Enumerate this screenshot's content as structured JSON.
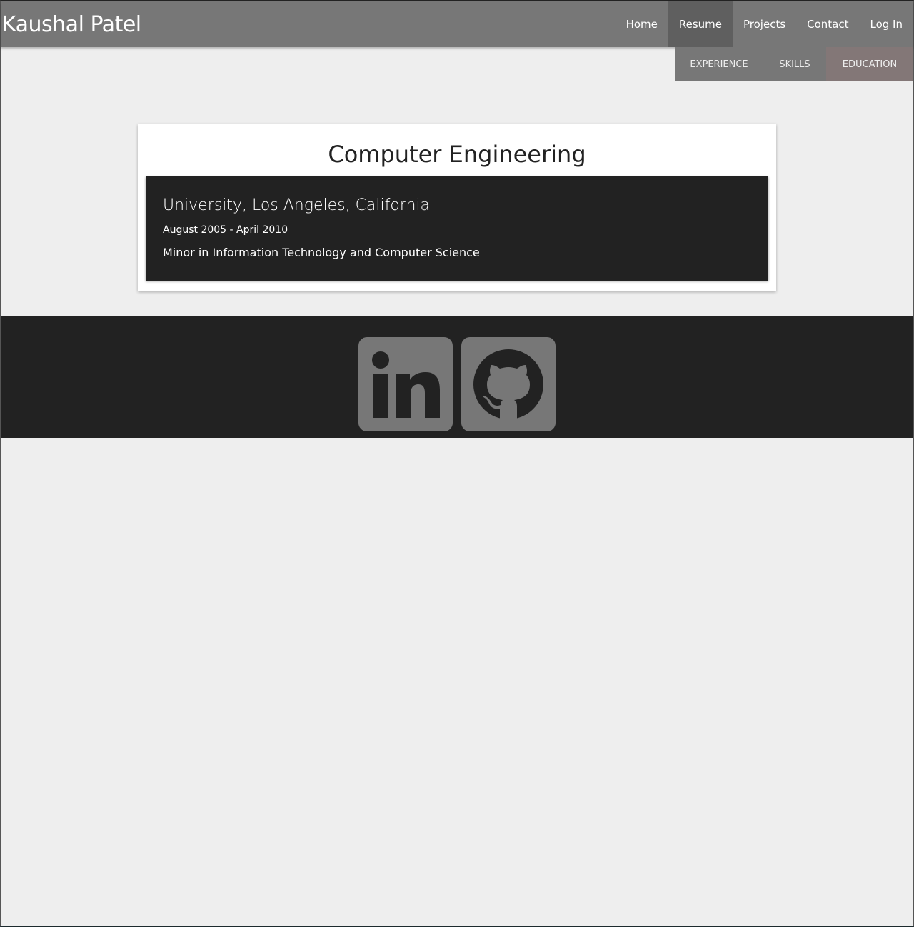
{
  "header": {
    "brand": "Kaushal Patel",
    "nav": [
      {
        "label": "Home"
      },
      {
        "label": "Resume"
      },
      {
        "label": "Projects"
      },
      {
        "label": "Contact"
      },
      {
        "label": "Log In"
      }
    ],
    "active_nav": "Resume"
  },
  "subnav": {
    "tabs": [
      {
        "label": "EXPERIENCE"
      },
      {
        "label": "SKILLS"
      },
      {
        "label": "EDUCATION"
      }
    ],
    "active_tab": "EDUCATION"
  },
  "main": {
    "title": "Computer Engineering",
    "entry": {
      "school": "University, Los Angeles, California",
      "dates": "August 2005 - April 2010",
      "description": "Minor in Information Technology and Computer Science"
    }
  },
  "footer": {
    "icons": [
      "linkedin-icon",
      "github-icon"
    ]
  },
  "colors": {
    "page_bg": "#eeeeee",
    "navbar_bg": "#777777",
    "active_nav_bg": "#5f5f5f",
    "active_tab_bg": "#837777",
    "dark_bg": "#222222",
    "card_bg": "#ffffff",
    "icon_gray": "#777777"
  }
}
